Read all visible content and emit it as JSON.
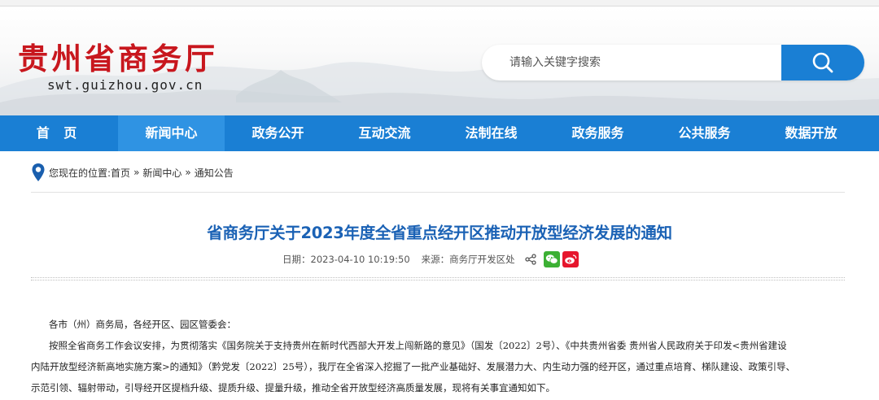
{
  "site": {
    "title": "贵州省商务厅",
    "url": "swt.guizhou.gov.cn"
  },
  "search": {
    "placeholder": "请输入关键字搜索",
    "button_icon": "search-icon"
  },
  "nav": {
    "items": [
      {
        "label": "首 页"
      },
      {
        "label": "新闻中心",
        "active": true
      },
      {
        "label": "政务公开"
      },
      {
        "label": "互动交流"
      },
      {
        "label": "法制在线"
      },
      {
        "label": "政务服务"
      },
      {
        "label": "公共服务"
      },
      {
        "label": "数据开放"
      }
    ]
  },
  "breadcrumb": {
    "prefix": "您现在的位置:",
    "items": [
      "首页",
      "新闻中心",
      "通知公告"
    ],
    "separator": "»"
  },
  "article": {
    "title": "省商务厅关于2023年度全省重点经开区推动开放型经济发展的通知",
    "date": "日期：2023-04-10 10:19:50",
    "source": "来源：商务厅开发区处",
    "share_icons": [
      "share-icon",
      "wechat-icon",
      "weibo-icon"
    ],
    "paragraphs": [
      "各市（州）商务局，各经开区、园区管委会：",
      "按照全省商务工作会议安排，为贯彻落实《国务院关于支持贵州在新时代西部大开发上闯新路的意见》（国发〔2022〕2号）、《中共贵州省委 贵州省人民政府关于印发<贵州省建设",
      "内陆开放型经济新高地实施方案>的通知》（黔党发〔2022〕25号），我厅在全省深入挖掘了一批产业基础好、发展潜力大、内生动力强的经开区，通过重点培育、梯队建设、政策引导、",
      "示范引领、辐射带动，引导经开区提档升级、提质升级、提量升级，推动全省开放型经济高质量发展，现将有关事宜通知如下。"
    ]
  },
  "colors": {
    "brand_red": "#c8171e",
    "nav_blue": "#1a7fd4",
    "nav_active": "#2f93e3",
    "title_blue": "#1b62b5",
    "wechat_green": "#3cb034",
    "weibo_red": "#e6162d"
  }
}
